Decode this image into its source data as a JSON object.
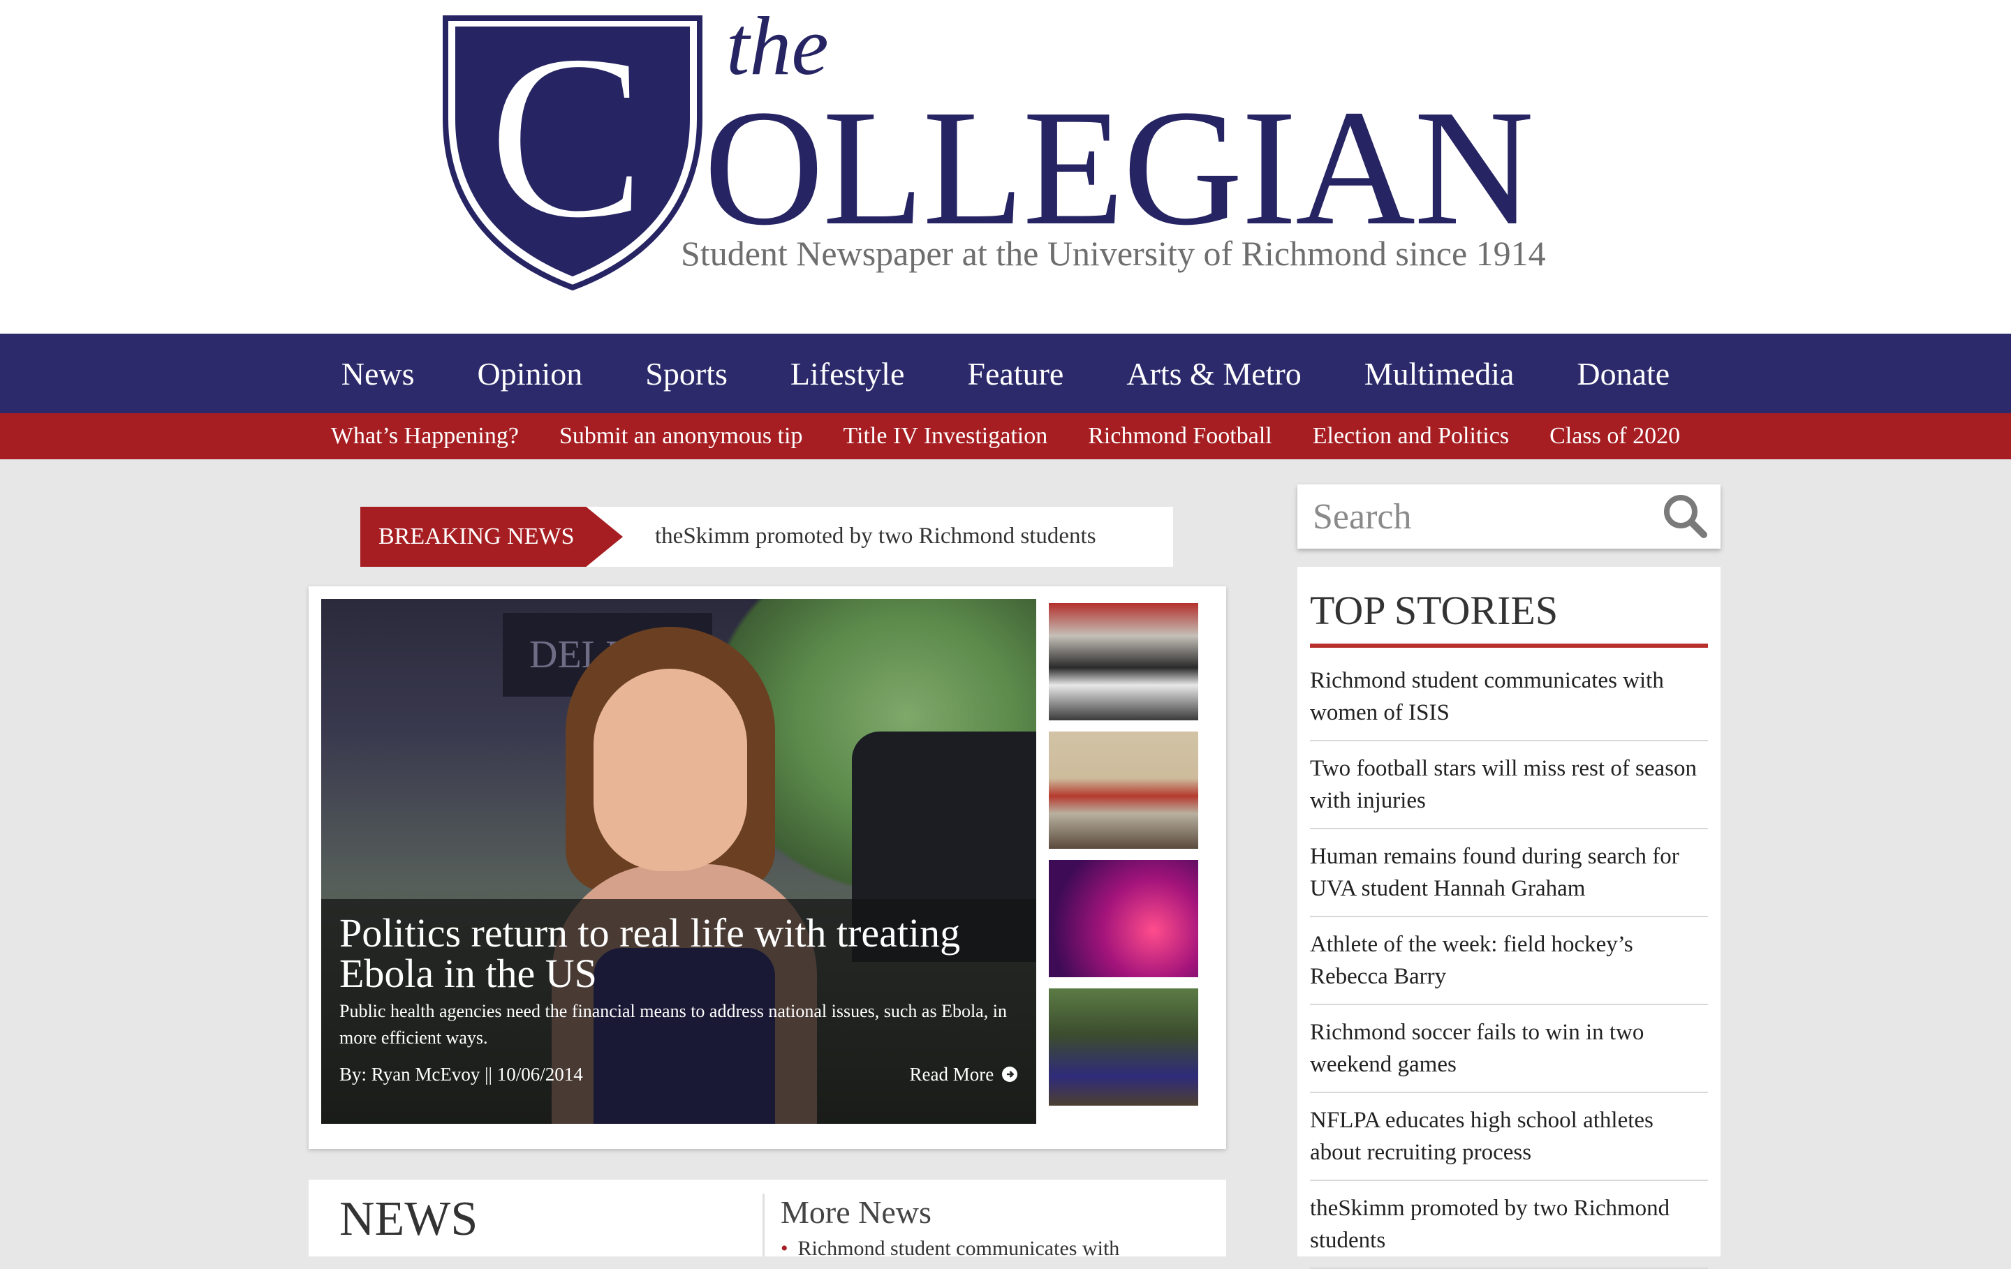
{
  "header": {
    "logo_the": "the",
    "logo_initial": "C",
    "logo_rest": "OLLEGIAN",
    "tagline": "Student Newspaper at the University of Richmond since 1914",
    "brand_color": "#262463"
  },
  "main_nav": {
    "items": [
      "News",
      "Opinion",
      "Sports",
      "Lifestyle",
      "Feature",
      "Arts & Metro",
      "Multimedia",
      "Donate"
    ],
    "color": "#2c2a6b"
  },
  "sub_nav": {
    "items": [
      "What’s Happening?",
      "Submit an anonymous tip",
      "Title IV Investigation",
      "Richmond Football",
      "Election and Politics",
      "Class of 2020"
    ],
    "color": "#a61e22"
  },
  "breaking": {
    "label": "BREAKING NEWS",
    "headline": "theSkimm promoted by two Richmond students"
  },
  "featured": {
    "hero_sign_text": "DELIRIO",
    "title": "Politics return to real life with treating Ebola in the US",
    "summary": "Public health agencies need the financial means to address national issues, such as Ebola, in more efficient ways.",
    "byline": "By: Ryan McEvoy || 10/06/2014",
    "read_more": "Read More"
  },
  "news_section": {
    "heading": "NEWS",
    "more_news_title": "More News",
    "more_news_first": "Richmond student communicates with"
  },
  "search": {
    "placeholder": "Search",
    "icon": "search-icon"
  },
  "top_stories": {
    "title": "TOP STORIES",
    "items": [
      "Richmond student communicates with women of ISIS",
      "Two football stars will miss rest of season with injuries",
      "Human remains found during search for UVA student Hannah Graham",
      "Athlete of the week: field hockey’s Rebecca Barry",
      "Richmond soccer fails to win in two weekend games",
      "NFLPA educates high school athletes about recruiting process",
      "theSkimm promoted by two Richmond students"
    ]
  }
}
